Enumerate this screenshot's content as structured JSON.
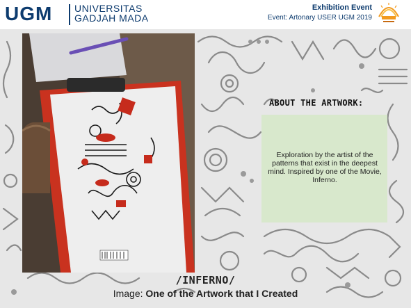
{
  "header": {
    "logo_mark": "UGM",
    "university_line1": "UNIVERSITAS",
    "university_line2": "GADJAH MADA",
    "event_title": "Exhibition Event",
    "event_subtitle": "Event: Artonary USER UGM 2019"
  },
  "about": {
    "heading": "ABOUT THE ARTWORK:",
    "description": "Exploration by the artist of the patterns that exist in the deepest mind. Inspired by one of the Movie, Inferno."
  },
  "caption": {
    "title": "/INFERNO/",
    "prefix": "Image: ",
    "text": "One of the Artwork that I Created"
  },
  "colors": {
    "brand_navy": "#0d3b6e",
    "panel_green": "#d6e8c8",
    "clipboard_red": "#d63a2a"
  }
}
